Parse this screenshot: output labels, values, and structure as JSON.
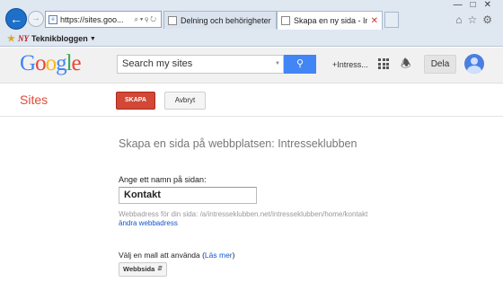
{
  "browser": {
    "address_url": "https://sites.goo...",
    "tabs": [
      {
        "label": "Delning och behörigheter - Int..."
      },
      {
        "label": "Skapa en ny sida - Intressekl..."
      }
    ],
    "favorites": {
      "label": "Teknikbloggen",
      "icon_text": "NY"
    }
  },
  "header": {
    "logo": [
      "G",
      "o",
      "o",
      "g",
      "l",
      "e"
    ],
    "search_placeholder": "Search my sites",
    "user_label": "+Intress...",
    "share_label": "Dela"
  },
  "sites": {
    "title": "Sites",
    "create_label": "SKAPA",
    "cancel_label": "Avbryt"
  },
  "form": {
    "heading": "Skapa en sida på webbplatsen: Intresseklubben",
    "name_label": "Ange ett namn på sidan:",
    "name_value": "Kontakt",
    "url_text": "Webbadress för din sida: /a/intresseklubben.net/intresseklubben/home/kontakt",
    "url_change": "ändra webbadress",
    "template_label_prefix": "Välj en mall att använda (",
    "template_link": "Läs mer",
    "template_label_suffix": ")",
    "template_value": "Webbsida"
  },
  "colors": {
    "accent_red": "#d14836",
    "accent_blue": "#4285f4",
    "link_blue": "#1155cc"
  }
}
